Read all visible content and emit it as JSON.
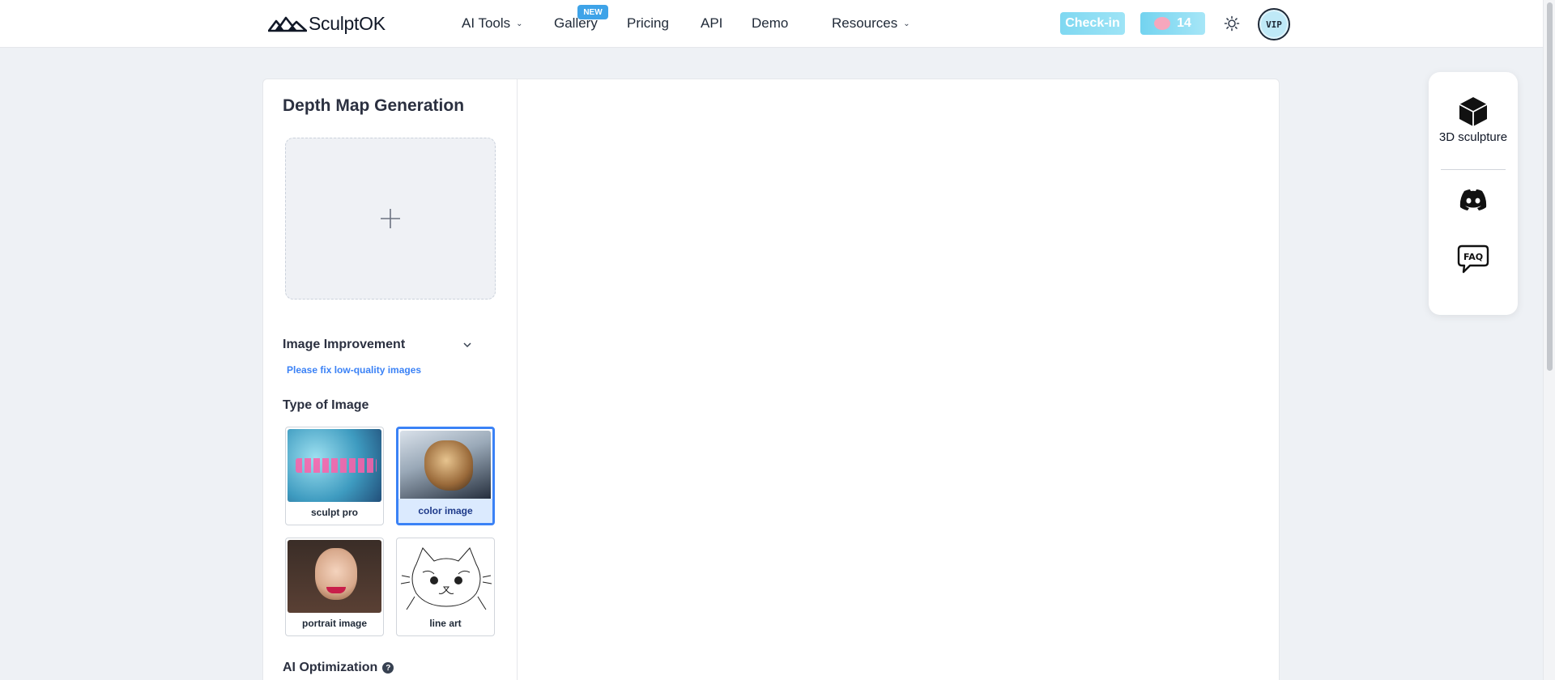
{
  "header": {
    "logo_text": "SculptOK",
    "nav": {
      "ai_tools": "AI Tools",
      "gallery": "Gallery",
      "gallery_badge": "NEW",
      "pricing": "Pricing",
      "api": "API",
      "demo": "Demo",
      "resources": "Resources"
    },
    "checkin_label": "Check-in",
    "credits": "14",
    "vip_label": "VIP"
  },
  "panel": {
    "title": "Depth Map Generation",
    "image_improvement_label": "Image Improvement",
    "image_improvement_hint": "Please fix low-quality images",
    "type_of_image_label": "Type of Image",
    "types": [
      {
        "label": "sculpt pro",
        "selected": false
      },
      {
        "label": "color image",
        "selected": true
      },
      {
        "label": "portrait image",
        "selected": false
      },
      {
        "label": "line art",
        "selected": false
      }
    ],
    "ai_optimization_label": "AI Optimization"
  },
  "side_panel": {
    "sculpture_label": "3D sculpture",
    "icons": [
      "cube-icon",
      "discord-icon",
      "faq-icon"
    ]
  },
  "colors": {
    "accent": "#3b82f6",
    "checkin": "#7fd8f1",
    "badge": "#3ea3e8"
  }
}
